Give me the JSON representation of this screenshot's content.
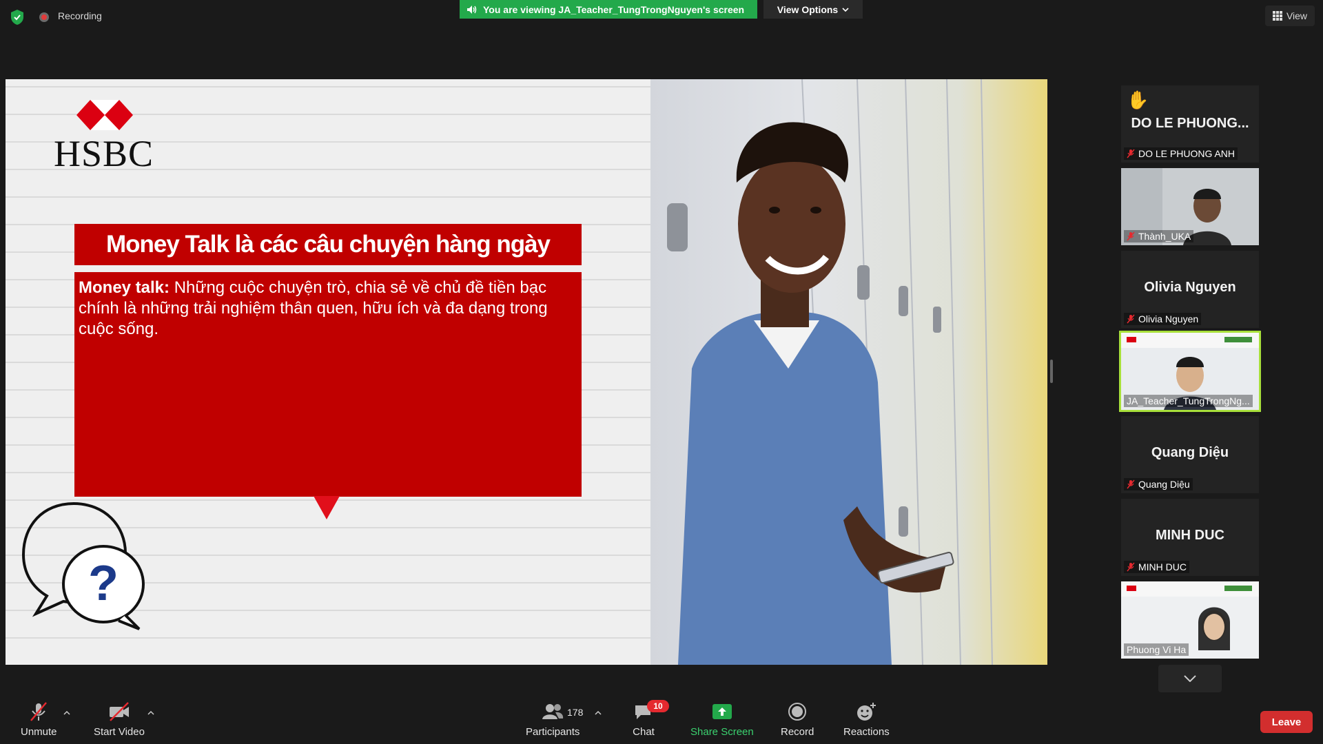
{
  "top_bar": {
    "recording_label": "Recording",
    "viewing_banner": "You are viewing JA_Teacher_TungTrongNguyen's screen",
    "view_options_label": "View Options",
    "view_label": "View"
  },
  "slide": {
    "logo_text": "HSBC",
    "title": "Money Talk là các câu chuyện hàng ngày",
    "body_bold": "Money talk:",
    "body_text": " Những cuộc chuyện trò, chia sẻ về chủ đề tiền bạc chính là những trải nghiệm thân quen, hữu ích và đa dạng trong cuộc sống."
  },
  "participants_panel": {
    "tiles": [
      {
        "big_name": "DO LE PHUONG...",
        "name": "DO LE PHUONG ANH",
        "raised_hand": true,
        "has_video": false,
        "active": false
      },
      {
        "big_name": "",
        "name": "Thành_UKA",
        "raised_hand": false,
        "has_video": true,
        "active": false
      },
      {
        "big_name": "Olivia Nguyen",
        "name": "Olivia Nguyen",
        "raised_hand": false,
        "has_video": false,
        "active": false
      },
      {
        "big_name": "",
        "name": "JA_Teacher_TungTrongNg...",
        "raised_hand": false,
        "has_video": true,
        "active": true
      },
      {
        "big_name": "Quang Diệu",
        "name": "Quang Diệu",
        "raised_hand": false,
        "has_video": false,
        "active": false
      },
      {
        "big_name": "MINH DUC",
        "name": "MINH DUC",
        "raised_hand": false,
        "has_video": false,
        "active": false
      },
      {
        "big_name": "",
        "name": "Phuong Vi Ha",
        "raised_hand": false,
        "has_video": true,
        "active": false
      }
    ]
  },
  "toolbar": {
    "unmute_label": "Unmute",
    "start_video_label": "Start Video",
    "participants_label": "Participants",
    "participants_count": "178",
    "chat_label": "Chat",
    "chat_badge": "10",
    "share_screen_label": "Share Screen",
    "record_label": "Record",
    "reactions_label": "Reactions",
    "leave_label": "Leave"
  },
  "colors": {
    "accent_green": "#23a94b",
    "hsbc_red": "#c00000",
    "leave_red": "#d22e2e",
    "active_speaker": "#a8e03a"
  }
}
